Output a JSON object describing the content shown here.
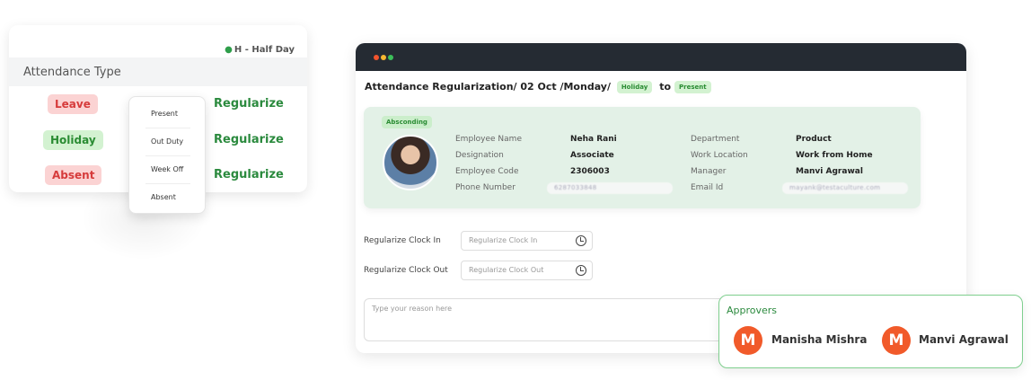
{
  "attendance": {
    "legend": "H - Half Day",
    "header": "Attendance Type",
    "rows": [
      {
        "badge": "Leave",
        "action": "Regularize"
      },
      {
        "badge": "Holiday",
        "action": "Regularize"
      },
      {
        "badge": "Absent",
        "action": "Regularize"
      }
    ],
    "dropdown_options": [
      "Present",
      "Out Duty",
      "Week Off",
      "Absent"
    ]
  },
  "window": {
    "title": "Attendance Regularization/ 02 Oct /Monday/",
    "from_tag": "Holiday",
    "to_word": "to",
    "to_tag": "Present",
    "status_tag": "Absconding",
    "employee": {
      "name_label": "Employee Name",
      "name": "Neha Rani",
      "designation_label": "Designation",
      "designation": "Associate",
      "code_label": "Employee Code",
      "code": "2306003",
      "phone_label": "Phone Number",
      "phone": "6287033848",
      "department_label": "Department",
      "department": "Product",
      "location_label": "Work Location",
      "location": "Work from Home",
      "manager_label": "Manager",
      "manager": "Manvi Agrawal",
      "email_label": "Email Id",
      "email": "mayank@testaculture.com"
    },
    "clock_in_label": "Regularize Clock In",
    "clock_in_placeholder": "Regularize Clock In",
    "clock_out_label": "Regularize Clock Out",
    "clock_out_placeholder": "Regularize Clock Out",
    "reason_placeholder": "Type your reason here"
  },
  "approvers": {
    "title": "Approvers",
    "people": [
      {
        "initial": "M",
        "name": "Manisha Mishra"
      },
      {
        "initial": "M",
        "name": "Manvi Agrawal"
      }
    ]
  },
  "colors": {
    "accent_green": "#2b8a3e",
    "danger_red": "#d63b3b",
    "titlebar": "#252b33",
    "avatar_orange": "#f15a2a",
    "dot_red": "#f2542d",
    "dot_yellow": "#f7b731",
    "dot_green": "#3cbf5a"
  }
}
